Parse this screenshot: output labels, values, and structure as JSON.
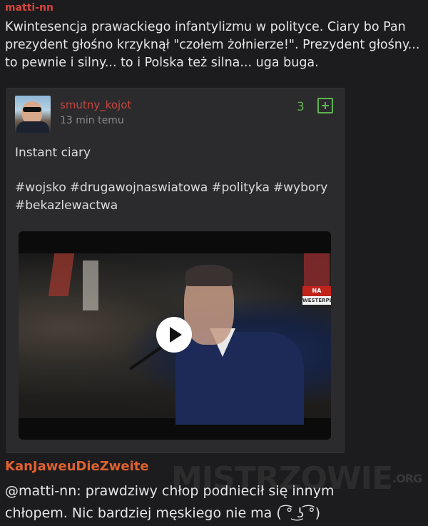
{
  "post": {
    "author": "matti-nn",
    "lines": [
      "Kwintesencja prawackiego infantylizmu w polityce. Ciary bo Pan",
      "prezydent głośno krzyknął \"czołem żołnierze!\". Prezydent głośny...",
      "to pewnie i silny... to i Polska też silna... uga buga."
    ]
  },
  "embed": {
    "author": "smutny_kojot",
    "time": "13 min temu",
    "votes": "3",
    "text": "Instant ciary",
    "tags": [
      "#wojsko",
      "#drugawojnaswiatowa",
      "#polityka",
      "#wybory",
      "#bekazlewactwa"
    ],
    "video": {
      "channel_tag": "NA",
      "location_tag": "WESTERPL"
    }
  },
  "comment": {
    "author": "KanJaweuDieZweite",
    "lines": [
      "@matti-nn: prawdziwy chłop podniecił się innym",
      "chłopem. Nic bardziej męskiego nie ma ( ͡° ͜ʖ ͡°)"
    ]
  },
  "watermark": {
    "text": "MISTRZOWIE",
    "suffix": ".ORG"
  },
  "colors": {
    "background": "#1c1c1e",
    "card": "#2b2b2d",
    "username_red": "#d9443d",
    "vote_green": "#5fb34f",
    "comment_user_orange": "#e0612f"
  }
}
